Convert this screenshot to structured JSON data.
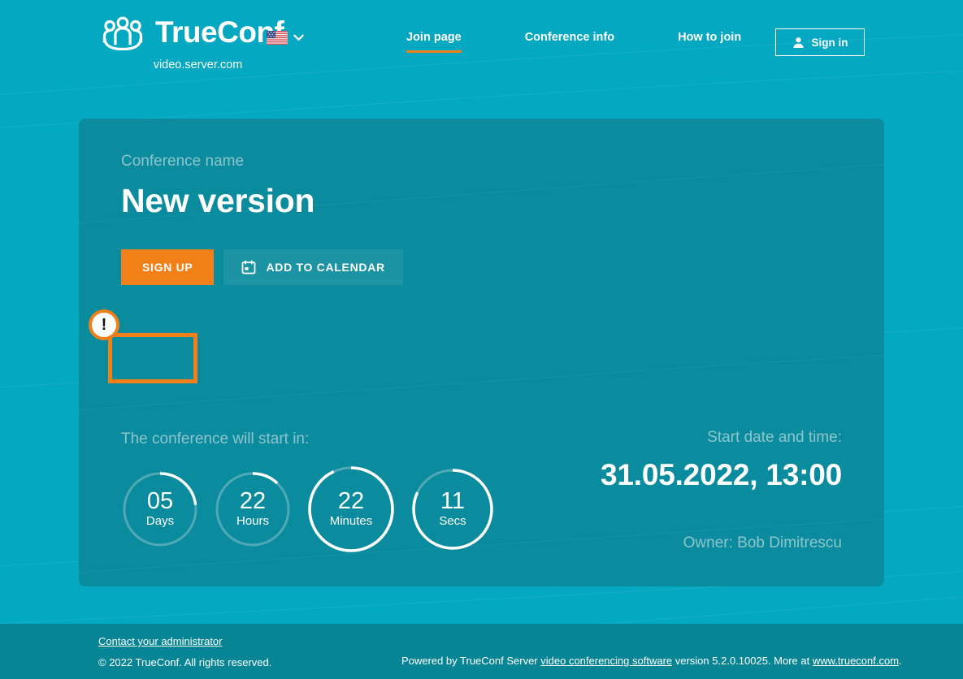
{
  "header": {
    "logo_text": "TrueConf",
    "logo_icon": "trueconf-people-logo",
    "domain": "video.server.com",
    "language": {
      "flag_icon": "us-flag-icon",
      "chevron_icon": "chevron-down-icon"
    },
    "nav": [
      {
        "label": "Join page",
        "active": true
      },
      {
        "label": "Conference info",
        "active": false
      },
      {
        "label": "How to join",
        "active": false
      }
    ],
    "signin": {
      "label": "Sign in",
      "icon": "person-icon"
    }
  },
  "card": {
    "conference_name_label": "Conference name",
    "conference_title": "New version",
    "signup_button": "SIGN UP",
    "calendar_button": "ADD TO CALENDAR",
    "calendar_icon": "calendar-icon",
    "annotation": {
      "badge_text": "!",
      "badge_icon": "exclamation-badge-icon",
      "highlight_color": "#f28019"
    },
    "countdown": {
      "label": "The conference will start in:",
      "items": [
        {
          "value": "05",
          "unit": "Days",
          "progress": 23,
          "size": 96,
          "track": "#51a9b5"
        },
        {
          "value": "22",
          "unit": "Hours",
          "progress": 12,
          "size": 96,
          "track": "#51a9b5"
        },
        {
          "value": "22",
          "unit": "Minutes",
          "progress": 93,
          "size": 108,
          "track": "#51a9b5"
        },
        {
          "value": "11",
          "unit": "Secs",
          "progress": 82,
          "size": 102,
          "track": "#51a9b5"
        }
      ]
    },
    "start": {
      "label": "Start date and time:",
      "value": "31.05.2022, 13:00",
      "owner": "Owner: Bob Dimitrescu"
    }
  },
  "footer": {
    "contact_link": "Contact your administrator",
    "copyright": "© 2022 TrueConf. All rights reserved.",
    "powered_prefix": "Powered by TrueConf Server ",
    "powered_link": "video conferencing software",
    "powered_mid": " version 5.2.0.10025. More at ",
    "powered_site": "www.trueconf.com",
    "powered_suffix": "."
  },
  "colors": {
    "page_bg": "#04a8c0",
    "card_bg": "#0a8c9e",
    "footer_bg": "#088595",
    "accent_orange": "#f28019",
    "muted_text": "#8fc4cc"
  }
}
